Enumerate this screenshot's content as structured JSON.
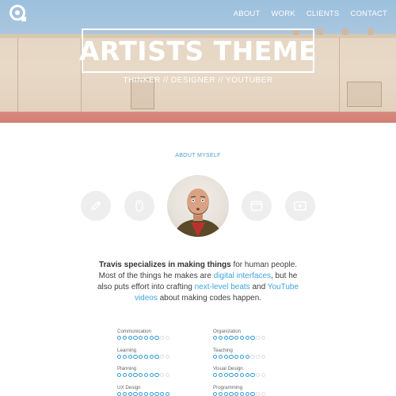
{
  "nav": {
    "items": [
      "ABOUT",
      "WORK",
      "CLIENTS",
      "CONTACT"
    ]
  },
  "hero": {
    "title": "ARTISTS THEME",
    "subtitle": "THINKER // DESIGNER // YOUTUBER"
  },
  "about": {
    "label": "ABOUT MYSELF",
    "icons": [
      "pencil-icon",
      "mouse-icon",
      "browser-window-icon",
      "video-play-icon"
    ],
    "bio": {
      "name_strong": "Travis specializes in making things",
      "t1": " for human people. Most of the things he makes are ",
      "link1": "digital interfaces",
      "t2": ", but he also puts effort into crafting ",
      "link2": "next-level beats",
      "t3": " and ",
      "link3": "YouTube videos",
      "t4": " about making codes happen."
    }
  },
  "skills": {
    "left": [
      {
        "name": "Communication",
        "level": 8,
        "max": 10
      },
      {
        "name": "Learning",
        "level": 8,
        "max": 10
      },
      {
        "name": "Planning",
        "level": 8,
        "max": 10
      },
      {
        "name": "UX Design",
        "level": 10,
        "max": 10
      }
    ],
    "right": [
      {
        "name": "Organization",
        "level": 8,
        "max": 10
      },
      {
        "name": "Teaching",
        "level": 7,
        "max": 10
      },
      {
        "name": "Visual Design",
        "level": 8,
        "max": 10
      },
      {
        "name": "Programming",
        "level": 8,
        "max": 10
      }
    ]
  },
  "colors": {
    "accent": "#3ea6df",
    "sky": "#a8c6df",
    "stripe": "#d98a7e",
    "icon_circle": "#eeeeee"
  }
}
